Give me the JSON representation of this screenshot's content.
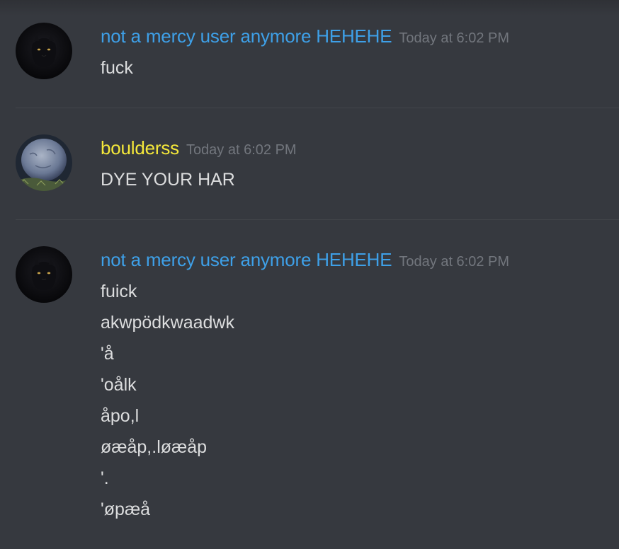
{
  "messages": [
    {
      "username": "not a mercy user anymore HEHEHE",
      "username_color": "#3ea0e8",
      "timestamp": "Today at 6:02 PM",
      "avatar": "black-panther-avatar",
      "lines": [
        "fuck"
      ]
    },
    {
      "username": "boulderss",
      "username_color": "#f5e83a",
      "timestamp": "Today at 6:02 PM",
      "avatar": "boulder-avatar",
      "lines": [
        "DYE YOUR HAR"
      ]
    },
    {
      "username": "not a mercy user anymore HEHEHE",
      "username_color": "#3ea0e8",
      "timestamp": "Today at 6:02 PM",
      "avatar": "black-panther-avatar",
      "lines": [
        "fuick",
        "akwpödkwaadwk",
        "'å",
        "'oålk",
        "åpo,l",
        "øæåp,.løæåp",
        "'.",
        "'øpæå"
      ]
    }
  ],
  "colors": {
    "background": "#36393f",
    "divider": "#42454a",
    "message_text": "#dcddde",
    "timestamp": "#72767d"
  }
}
